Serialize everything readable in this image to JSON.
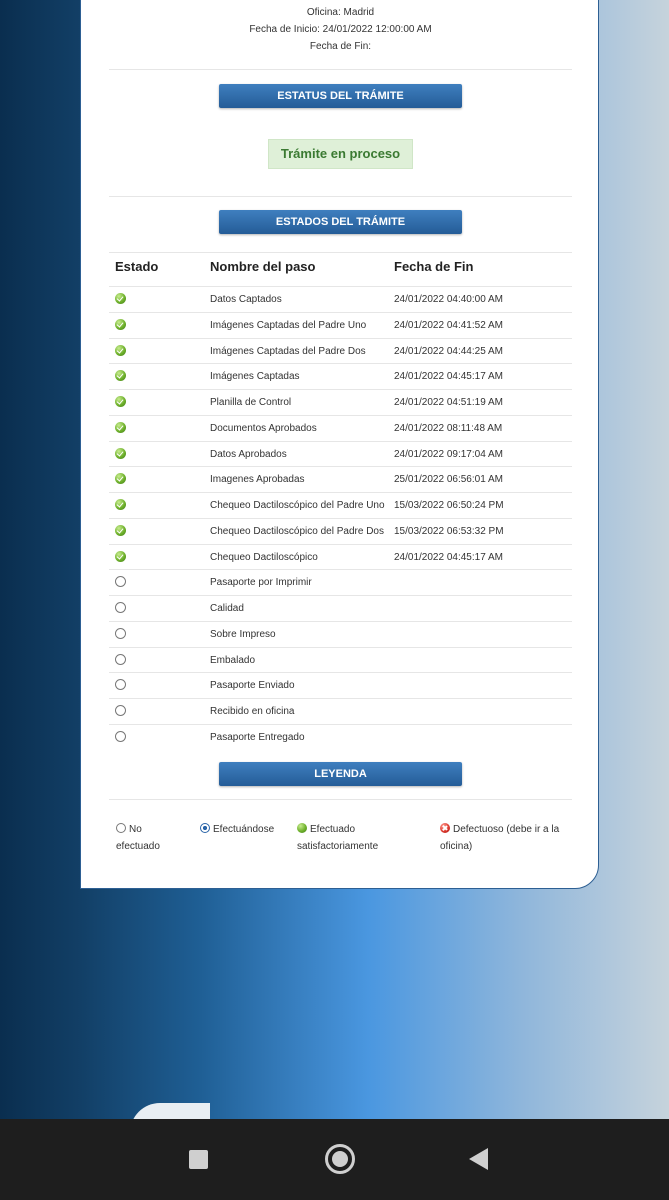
{
  "info": {
    "oficina": "Oficina: Madrid",
    "fecha_inicio": "Fecha de Inicio: 24/01/2022 12:00:00 AM",
    "fecha_fin": "Fecha de Fin:"
  },
  "estatus": {
    "header": "ESTATUS DEL TRÁMITE",
    "value": "Trámite en proceso"
  },
  "estados": {
    "header": "ESTADOS DEL TRÁMITE",
    "columns": [
      "Estado",
      "Nombre del paso",
      "Fecha de Fin"
    ],
    "rows": [
      {
        "state": "done",
        "name": "Datos Captados",
        "date": "24/01/2022 04:40:00 AM"
      },
      {
        "state": "done",
        "name": "Imágenes Captadas del Padre Uno",
        "date": "24/01/2022 04:41:52 AM"
      },
      {
        "state": "done",
        "name": "Imágenes Captadas del Padre Dos",
        "date": "24/01/2022 04:44:25 AM"
      },
      {
        "state": "done",
        "name": "Imágenes Captadas",
        "date": "24/01/2022 04:45:17 AM"
      },
      {
        "state": "done",
        "name": "Planilla de Control",
        "date": "24/01/2022 04:51:19 AM"
      },
      {
        "state": "done",
        "name": "Documentos Aprobados",
        "date": "24/01/2022 08:11:48 AM"
      },
      {
        "state": "done",
        "name": "Datos Aprobados",
        "date": "24/01/2022 09:17:04 AM"
      },
      {
        "state": "done",
        "name": "Imagenes Aprobadas",
        "date": "25/01/2022 06:56:01 AM"
      },
      {
        "state": "done",
        "name": "Chequeo Dactiloscópico del Padre Uno",
        "date": "15/03/2022 06:50:24 PM"
      },
      {
        "state": "done",
        "name": "Chequeo Dactiloscópico del Padre Dos",
        "date": "15/03/2022 06:53:32 PM"
      },
      {
        "state": "done",
        "name": "Chequeo Dactiloscópico",
        "date": "24/01/2022 04:45:17 AM"
      },
      {
        "state": "todo",
        "name": "Pasaporte por Imprimir",
        "date": ""
      },
      {
        "state": "todo",
        "name": "Calidad",
        "date": ""
      },
      {
        "state": "todo",
        "name": "Sobre Impreso",
        "date": ""
      },
      {
        "state": "todo",
        "name": "Embalado",
        "date": ""
      },
      {
        "state": "todo",
        "name": "Pasaporte Enviado",
        "date": ""
      },
      {
        "state": "todo",
        "name": "Recibido en oficina",
        "date": ""
      },
      {
        "state": "todo",
        "name": "Pasaporte Entregado",
        "date": ""
      }
    ]
  },
  "leyenda": {
    "header": "LEYENDA",
    "items": [
      {
        "icon": "not-done-icon",
        "line1": "No",
        "line2": "efectuado"
      },
      {
        "icon": "in-progress-icon",
        "line1": "Efectuándose",
        "line2": ""
      },
      {
        "icon": "done-icon",
        "line1": "Efectuado",
        "line2": "satisfactoriamente"
      },
      {
        "icon": "defective-icon",
        "line1": "Defectuoso (debe ir a la",
        "line2": "oficina)"
      }
    ]
  },
  "colors": {
    "header_button": "#2f6ea8",
    "status_text": "#3b7a32",
    "status_bg": "#dff0d8"
  }
}
